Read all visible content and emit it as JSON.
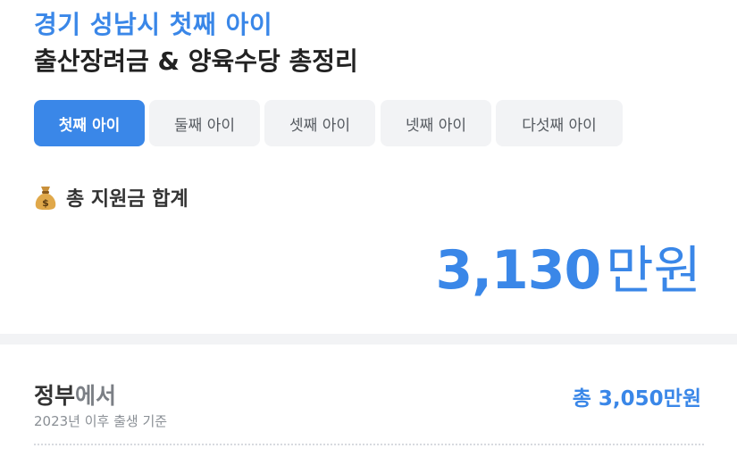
{
  "header": {
    "title_line1": "경기 성남시 첫째 아이",
    "title_line2": "출산장려금 & 양육수당 총정리"
  },
  "tabs": [
    {
      "label": "첫째 아이",
      "active": true
    },
    {
      "label": "둘째 아이",
      "active": false
    },
    {
      "label": "셋째 아이",
      "active": false
    },
    {
      "label": "넷째 아이",
      "active": false
    },
    {
      "label": "다섯째 아이",
      "active": false
    }
  ],
  "summary": {
    "icon": "money-bag-icon",
    "label": "총 지원금 합계",
    "amount": "3,130",
    "unit": "만원"
  },
  "government_section": {
    "title_main": "정부",
    "title_suffix": "에서",
    "subtitle": "2023년 이후 출생 기준",
    "total": "총 3,050만원"
  },
  "colors": {
    "accent": "#3a87e8",
    "tab_bg": "#f2f3f5",
    "text_dark": "#222222"
  }
}
